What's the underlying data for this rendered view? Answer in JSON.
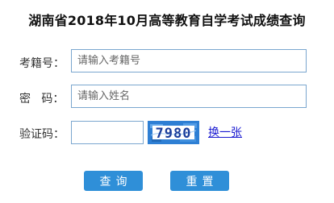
{
  "page": {
    "title": "湖南省2018年10月高等教育自学考试成绩查询"
  },
  "form": {
    "exam_id": {
      "label": "考籍号：",
      "placeholder": "请输入考籍号",
      "value": ""
    },
    "password": {
      "label": "密   码：",
      "placeholder": "请输入姓名",
      "value": ""
    },
    "captcha": {
      "label": "验证码：",
      "value": "",
      "image_text": "7980",
      "refresh_label": "换一张"
    }
  },
  "buttons": {
    "query_label": "查询",
    "reset_label": "重置"
  },
  "colors": {
    "accent": "#2f8fd8",
    "input_border": "#7aa6cf",
    "captcha_bg": "#2e7fd4",
    "link": "#1a1ad1"
  }
}
